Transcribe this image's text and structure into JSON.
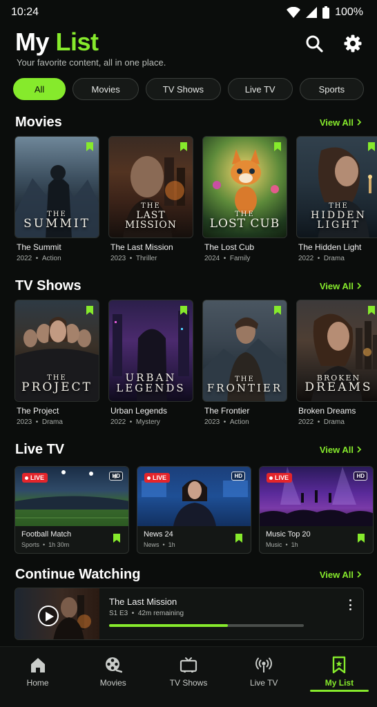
{
  "status": {
    "time": "10:24",
    "battery": "100%"
  },
  "header": {
    "title_main": "My",
    "title_accent": "List",
    "subtitle": "Your favorite content, all in one place."
  },
  "filters": [
    "All",
    "Movies",
    "TV Shows",
    "Live TV",
    "Sports"
  ],
  "active_filter": "All",
  "sections": {
    "movies": {
      "title": "Movies",
      "view_all": "View All",
      "items": [
        {
          "title": "The Summit",
          "year": "2022",
          "genre": "Action",
          "poster_small": "THE",
          "poster_big": "SUMMIT"
        },
        {
          "title": "The Last Mission",
          "year": "2023",
          "genre": "Thriller",
          "poster_small": "THE",
          "poster_big": "LAST MISSION"
        },
        {
          "title": "The Lost Cub",
          "year": "2024",
          "genre": "Family",
          "poster_small": "THE",
          "poster_big": "LOST CUB"
        },
        {
          "title": "The Hidden Light",
          "year": "2022",
          "genre": "Drama",
          "poster_small": "THE",
          "poster_big": "HIDDEN LIGHT"
        }
      ]
    },
    "tv_shows": {
      "title": "TV Shows",
      "view_all": "View All",
      "items": [
        {
          "title": "The Project",
          "year": "2023",
          "genre": "Drama",
          "poster_small": "THE",
          "poster_big": "PROJECT"
        },
        {
          "title": "Urban Legends",
          "year": "2022",
          "genre": "Mystery",
          "poster_small": "",
          "poster_big": "URBAN LEGENDS"
        },
        {
          "title": "The Frontier",
          "year": "2023",
          "genre": "Action",
          "poster_small": "THE",
          "poster_big": "FRONTIER"
        },
        {
          "title": "Broken Dreams",
          "year": "2022",
          "genre": "Drama",
          "poster_small": "BROKEN",
          "poster_big": "DREAMS"
        }
      ]
    },
    "live_tv": {
      "title": "Live TV",
      "view_all": "View All",
      "live_label": "LIVE",
      "hd_label": "HD",
      "items": [
        {
          "title": "Football Match",
          "category": "Sports",
          "duration": "1h 30m"
        },
        {
          "title": "News 24",
          "category": "News",
          "duration": "1h"
        },
        {
          "title": "Music Top 20",
          "category": "Music",
          "duration": "1h"
        }
      ]
    },
    "continue_watching": {
      "title": "Continue Watching",
      "view_all": "View All",
      "item": {
        "title": "The Last Mission",
        "episode": "S1 E3",
        "remaining": "42m remaining",
        "progress": 0.61
      }
    }
  },
  "bottom_nav": [
    {
      "label": "Home",
      "icon": "home-icon"
    },
    {
      "label": "Movies",
      "icon": "film-reel-icon"
    },
    {
      "label": "TV Shows",
      "icon": "tv-icon"
    },
    {
      "label": "Live TV",
      "icon": "broadcast-icon"
    },
    {
      "label": "My List",
      "icon": "bookmark-icon",
      "active": true
    }
  ],
  "colors": {
    "accent": "#86ea2c",
    "background": "#0b0d0c",
    "live_red": "#e4252b"
  }
}
